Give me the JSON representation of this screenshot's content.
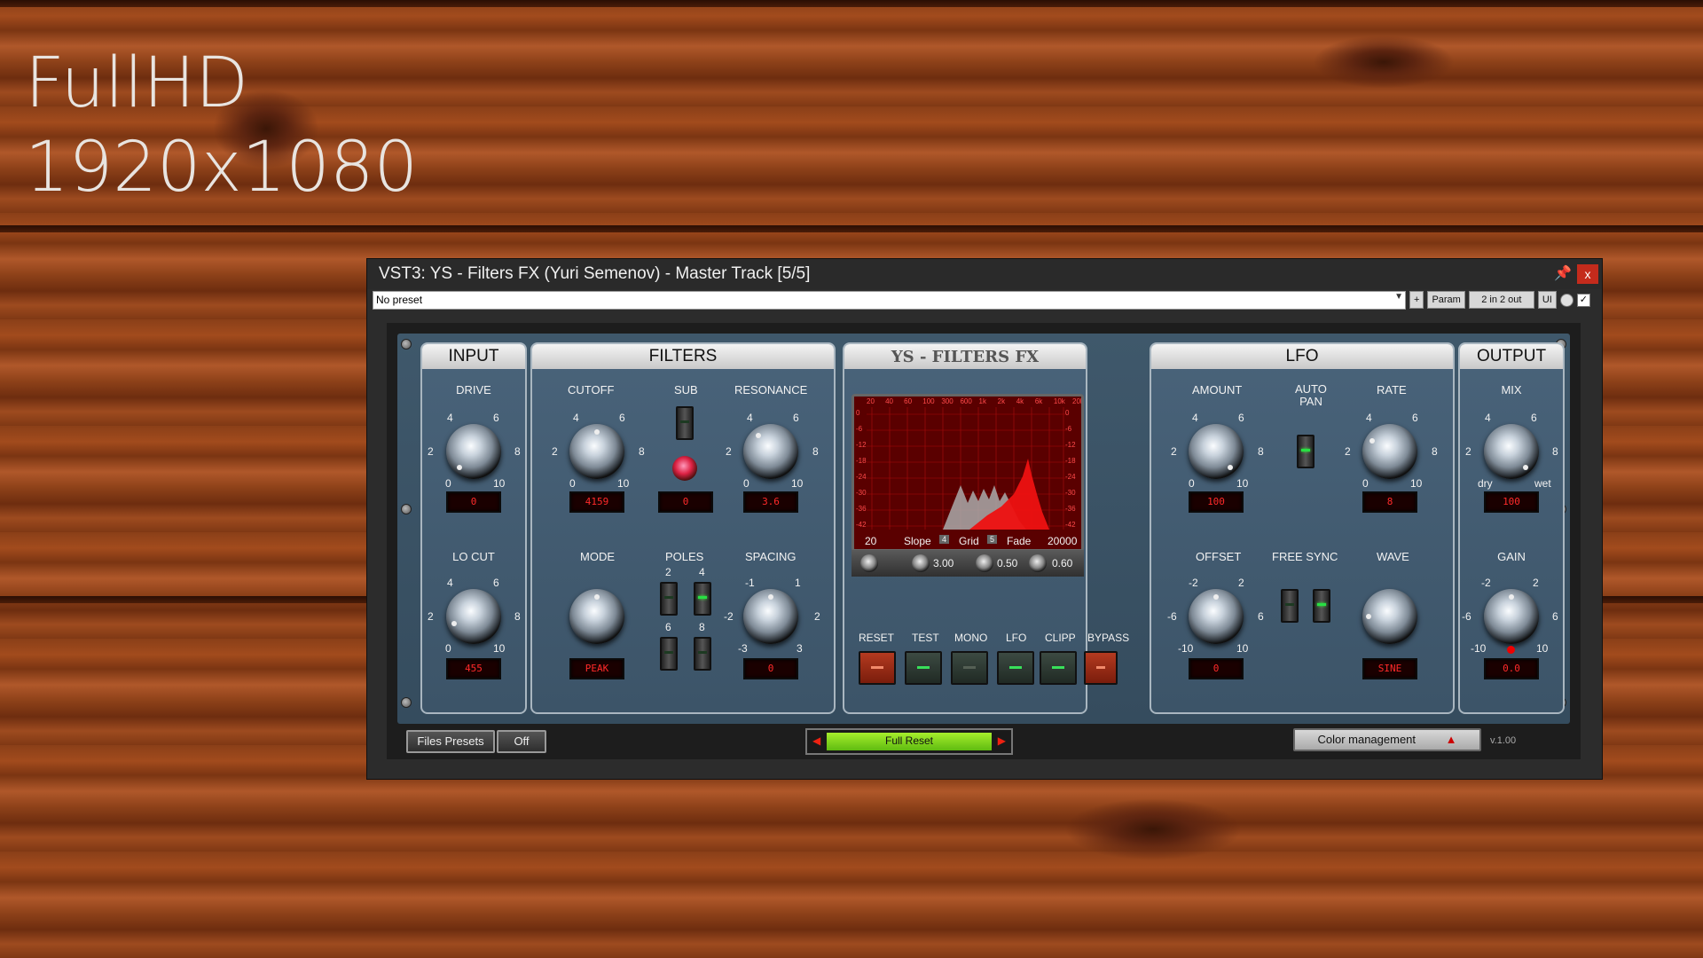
{
  "overlay": {
    "line1": "FullHD",
    "line2": "1920x1080"
  },
  "window": {
    "title": "VST3: YS - Filters FX (Yuri Semenov) - Master Track [5/5]",
    "pin_icon": "pin-icon",
    "close_label": "x"
  },
  "toolbar": {
    "preset": "No preset",
    "plus": "+",
    "param": "Param",
    "io": "2 in 2 out",
    "ui": "UI",
    "check": "✓"
  },
  "input": {
    "title": "INPUT",
    "drive_label": "DRIVE",
    "drive_value": "0",
    "locut_label": "LO CUT",
    "locut_value": "455"
  },
  "filters": {
    "title": "FILTERS",
    "cutoff_label": "CUTOFF",
    "cutoff_value": "4159",
    "sub_label": "SUB",
    "sub_value": "0",
    "resonance_label": "RESONANCE",
    "resonance_value": "3.6",
    "mode_label": "MODE",
    "mode_value": "PEAK",
    "poles_label": "POLES",
    "poles_2": "2",
    "poles_4": "4",
    "poles_6": "6",
    "poles_8": "8",
    "spacing_label": "SPACING",
    "spacing_value": "0"
  },
  "center": {
    "title": "YS - FILTERS FX",
    "freq_ticks": [
      "20",
      "40",
      "60",
      "100",
      "300",
      "600",
      "1k",
      "2k",
      "4k",
      "6k",
      "10k",
      "20k"
    ],
    "db_ticks": [
      "0",
      "-6",
      "-12",
      "-18",
      "-24",
      "-30",
      "-36",
      "-42"
    ],
    "range_min": "20",
    "range_max": "20000",
    "slope_label": "Slope",
    "slope_value": "4",
    "grid_label": "Grid",
    "grid_value": "5",
    "fade_label": "Fade",
    "val1": "3.00",
    "val2": "0.50",
    "val3": "0.60",
    "btn_reset": "RESET",
    "btn_test": "TEST",
    "btn_mono": "MONO",
    "btn_lfo": "LFO",
    "btn_clipp": "CLIPP",
    "btn_bypass": "BYPASS"
  },
  "lfo": {
    "title": "LFO",
    "amount_label": "AMOUNT",
    "amount_value": "100",
    "autopan_label": "AUTO\nPAN",
    "rate_label": "RATE",
    "rate_value": "8",
    "offset_label": "OFFSET",
    "offset_value": "0",
    "freesync_label": "FREE SYNC",
    "wave_label": "WAVE",
    "wave_value": "SINE"
  },
  "output": {
    "title": "OUTPUT",
    "mix_label": "MIX",
    "mix_value": "100",
    "dry": "dry",
    "wet": "wet",
    "gain_label": "GAIN",
    "gain_value": "0.0"
  },
  "ticks": {
    "t0": "0",
    "t2": "2",
    "t4": "4",
    "t6": "6",
    "t8": "8",
    "t10": "10",
    "s_m2": "-2",
    "s_m1": "-1",
    "s_1": "1",
    "s_2": "2",
    "s_m3": "-3",
    "s_3": "3",
    "o_m2": "-2",
    "o_2": "2",
    "o_m6": "-6",
    "o_6": "6",
    "o_m10": "-10",
    "o_10": "10"
  },
  "bottom": {
    "files": "Files",
    "presets": "Presets",
    "off": "Off",
    "full_reset": "Full Reset",
    "color_mgmt": "Color management",
    "version": "v.1.00"
  },
  "colors": {
    "led_red": "#ff2a2a",
    "led_green": "#28e044",
    "reset_green": "#8fdd22"
  }
}
